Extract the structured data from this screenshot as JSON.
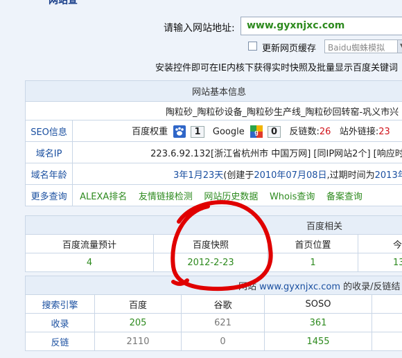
{
  "top_cut_text": "网站查",
  "url": {
    "label": "请输入网站地址:",
    "value": "www.gyxnjxc.com"
  },
  "cache": {
    "label": "更新网页缓存",
    "select_value": "Baidu蜘蛛模拟"
  },
  "notice": "安装控件即可在IE内核下获得实时快照及批量显示百度关键词",
  "basic_info": {
    "header": "网站基本信息",
    "site_title": "陶粒砂_陶粒砂设备_陶粒砂生产线_陶粒砂回转窑-巩义市兴",
    "seo": {
      "label": "SEO信息",
      "baidu_weight_label": "百度权重",
      "baidu_weight": "1",
      "google_label": "Google",
      "google_pr": "0",
      "backlinks_label": "反链数:",
      "backlinks": "26",
      "outlinks_label": "站外链接:",
      "outlinks": "23"
    },
    "domain_ip": {
      "label": "域名IP",
      "value": "223.6.92.132[浙江省杭州市 中国万网]",
      "same_ip": "[同IP网站2个]",
      "resp": "[响应时"
    },
    "domain_age": {
      "label": "域名年龄",
      "age": "3年1月23天",
      "detail_a": "(创建于",
      "created": "2010年07月08日",
      "detail_b": ",过期时间为",
      "expires": "2013年0"
    },
    "more": {
      "label": "更多查询",
      "links": [
        "ALEXA排名",
        "友情链接检测",
        "网站历史数据",
        "Whois查询",
        "备案查询"
      ]
    }
  },
  "baidu": {
    "header": "百度相关",
    "cols": [
      "百度流量预计",
      "百度快照",
      "首页位置",
      "今日"
    ],
    "values": [
      "4",
      "2012-2-23",
      "1",
      "13"
    ]
  },
  "index": {
    "header_prefix": "网站",
    "header_domain": "www.gyxnjxc.com",
    "header_suffix": "的收录/反链结",
    "cols": [
      "搜索引擎",
      "百度",
      "谷歌",
      "SOSO"
    ],
    "rows": [
      {
        "label": "收录",
        "baidu": "205",
        "google": "621",
        "soso": "361"
      },
      {
        "label": "反链",
        "baidu": "2110",
        "google": "0",
        "soso": "1455"
      }
    ]
  },
  "colors": {
    "accent": "#1a4fa0",
    "green": "#2d8a1e",
    "red": "#d0121a",
    "ink": "#e00000"
  }
}
